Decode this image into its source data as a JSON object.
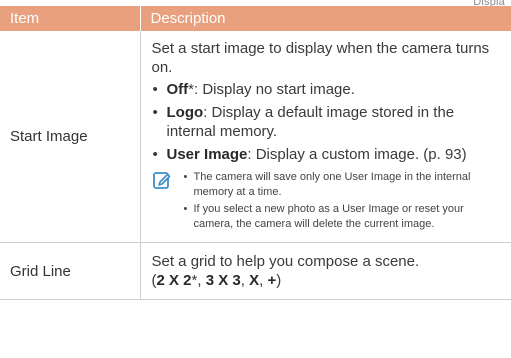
{
  "page": {
    "top_fragment": "Displa"
  },
  "table": {
    "headers": {
      "item": "Item",
      "description": "Description"
    },
    "rows": {
      "start_image": {
        "item": "Start Image",
        "intro": "Set a start image to display when the camera turns on.",
        "options": [
          {
            "term": "Off",
            "mark": "*",
            "text": ": Display no start image."
          },
          {
            "term": "Logo",
            "mark": "",
            "text": ": Display a default image stored in the internal memory."
          },
          {
            "term": "User Image",
            "mark": "",
            "text": ": Display a custom image. (p. 93)"
          }
        ],
        "note_icon": "note-pencil-icon",
        "notes": [
          "The camera will save only one User Image in the internal memory at a time.",
          "If you select a new photo as a User Image or reset your camera, the camera will delete the current image."
        ]
      },
      "grid_line": {
        "item": "Grid Line",
        "text": "Set a grid to help you compose a scene.",
        "open_paren": "(",
        "options": [
          "2 X 2",
          "3 X 3",
          "X",
          "+"
        ],
        "default_mark": "*",
        "separator": ", ",
        "close_paren": ")"
      }
    }
  },
  "colors": {
    "header_bg": "#e8a07e",
    "header_text": "#ffffff",
    "rule": "#cfcfcf",
    "icon": "#3d8fc8"
  }
}
